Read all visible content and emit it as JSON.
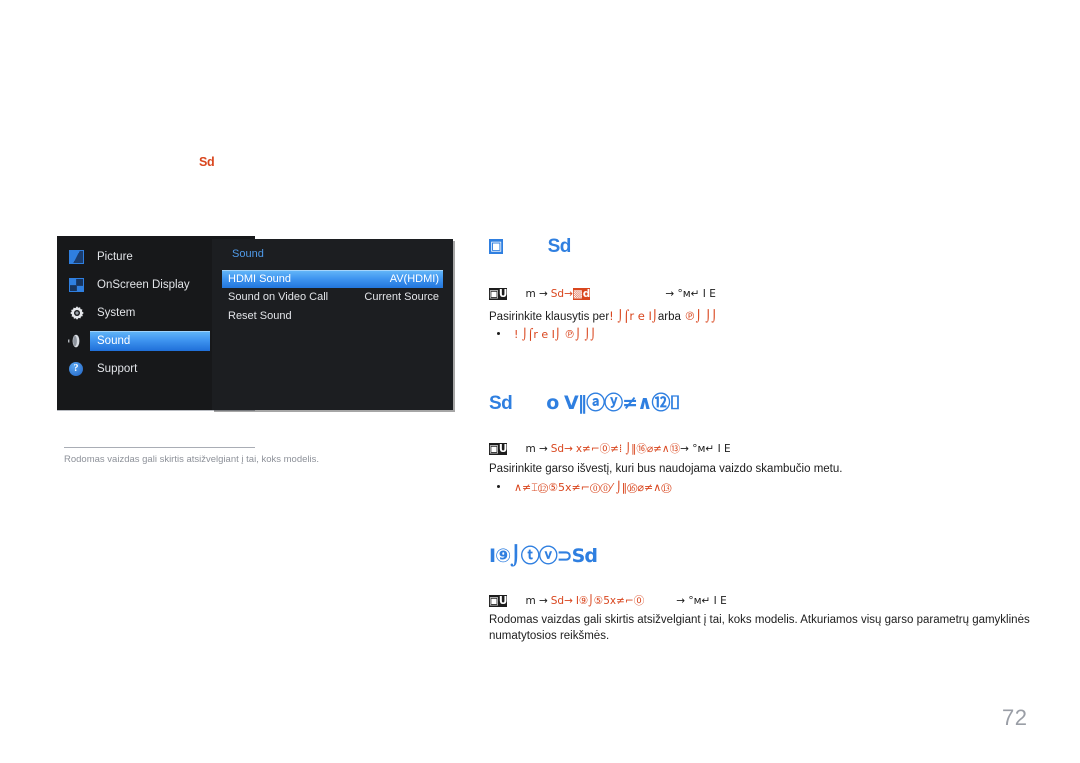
{
  "document": {
    "page_number": "72",
    "chapter_marker": "Sd"
  },
  "osd": {
    "menu_title": "Sound",
    "sidebar": {
      "items": [
        {
          "label": "Picture",
          "icon": "picture-icon",
          "selected": false
        },
        {
          "label": "OnScreen Display",
          "icon": "onscreen-display-icon",
          "selected": false
        },
        {
          "label": "System",
          "icon": "gear-icon",
          "selected": false
        },
        {
          "label": "Sound",
          "icon": "speaker-icon",
          "selected": true
        },
        {
          "label": "Support",
          "icon": "question-mark-icon",
          "selected": false
        }
      ]
    },
    "rows": [
      {
        "label": "HDMI Sound",
        "value": "AV(HDMI)",
        "selected": true
      },
      {
        "label": "Sound on Video Call",
        "value": "Current Source",
        "selected": false
      },
      {
        "label": "Reset Sound",
        "value": "",
        "selected": false
      }
    ]
  },
  "caption": {
    "text": "Rodomas vaizdas gali skirtis atsižvelgiant į tai, koks modelis."
  },
  "sections": [
    {
      "heading_prefix": "▣",
      "heading": "Sd",
      "nav_prefix": "▣U",
      "nav_mid": "m →",
      "nav_red_1": "Sd→",
      "nav_red_2": "▩d",
      "nav_suffix": "→ °м↵ I E",
      "body_before": "Pasirinkite klausytis per",
      "body_red_1": "! ⌡⌠r e I⌡",
      "body_mid": "arba",
      "body_red_2": "℗⌡ ⌡⌡",
      "bullet": "! ⌡⌠r e I⌡  ℗⌡ ⌡⌡"
    },
    {
      "heading": "Sd",
      "heading_extra": "o  V‖ⓐⓨ≠∧⑫⌷",
      "nav_prefix": "▣U",
      "nav_mid": "m →",
      "nav_red_1": "Sd→",
      "nav_red_2": "x≠⌐⓪≠⁞ ⌡‖⑯⌀≠∧⑬",
      "nav_suffix": "→ °м↵ I    E",
      "body": "Pasirinkite garso išvestį, kuri bus naudojama vaizdo skambučio metu.",
      "bullet": "∧≠⌶⑫⑤5x≠⌐⓪⓪⁄ ⌡‖⑯⌀≠∧⑬"
    },
    {
      "heading": "I⑨⌡ⓣⓥ⊃Sd",
      "nav_prefix": "▣U",
      "nav_mid": "m →",
      "nav_red_1": "Sd→",
      "nav_red_2": "I⑨⌡⑤5x≠⌐⓪",
      "nav_suffix": "→ °м↵ I E",
      "body": "Rodomas vaizdas gali skirtis atsižvelgiant į tai, koks modelis. Atkuriamos visų garso parametrų gamyklinės numatytosios reikšmės."
    }
  ],
  "colors": {
    "accent_blue": "#2f7fe0",
    "accent_red": "#d9461e",
    "osd_bg_left": "#17181a",
    "osd_bg_right": "#1c1e21"
  }
}
